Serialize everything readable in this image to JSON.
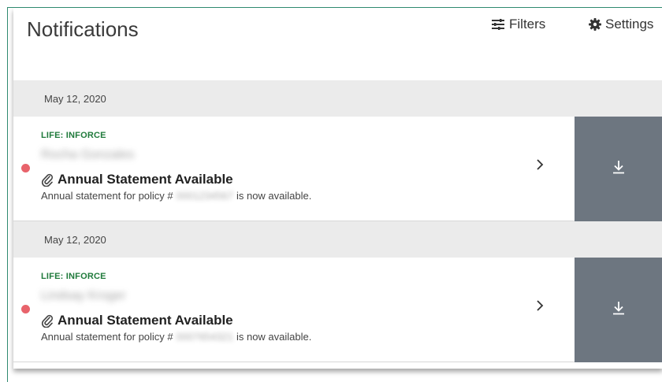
{
  "header": {
    "title": "Notifications",
    "filters_label": "Filters",
    "settings_label": "Settings",
    "filters_icon": "filters-icon",
    "settings_icon": "gear-icon"
  },
  "notifications": [
    {
      "date": "May 12, 2020",
      "category": "LIFE: INFORCE",
      "name": "Rocha Gonzales",
      "title": "Annual Statement Available",
      "desc_prefix": "Annual statement for policy #",
      "policy_number": "0001234567",
      "desc_suffix": "is now available.",
      "unread": true
    },
    {
      "date": "May 12, 2020",
      "category": "LIFE: INFORCE",
      "name": "Lindsay Kroger",
      "title": "Annual Statement Available",
      "desc_prefix": "Annual statement for policy #",
      "policy_number": "0007654321",
      "desc_suffix": "is now available.",
      "unread": true
    }
  ],
  "colors": {
    "accent_green": "#1f7a3b",
    "unread_dot": "#e8636b",
    "download_bg": "#6d7680",
    "date_bar_bg": "#ebebeb"
  }
}
